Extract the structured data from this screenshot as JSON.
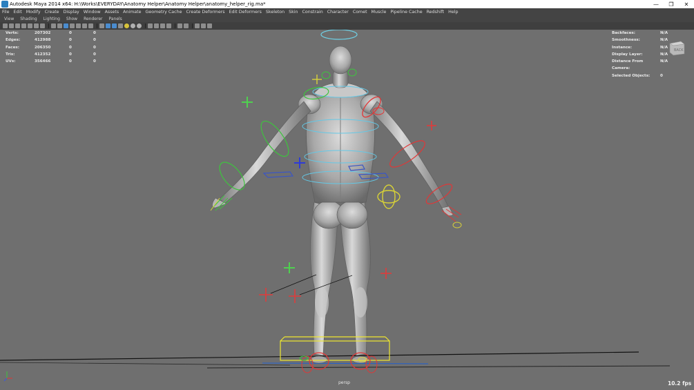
{
  "window": {
    "title": "Autodesk Maya 2014 x64: H:\\Works\\EVERYDAY\\Anatomy Helper\\Anatomy Helper\\anatomy_helper_rig.ma*",
    "minimize": "—",
    "restore": "❐",
    "close": "✕"
  },
  "main_menu": [
    "File",
    "Edit",
    "Modify",
    "Create",
    "Display",
    "Window",
    "Assets",
    "Animate",
    "Geometry Cache",
    "Create Deformers",
    "Edit Deformers",
    "Skeleton",
    "Skin",
    "Constrain",
    "Character",
    "Comet",
    "Muscle",
    "Pipeline Cache",
    "Redshift",
    "Help"
  ],
  "panel_menu": [
    "View",
    "Shading",
    "Lighting",
    "Show",
    "Renderer",
    "Panels"
  ],
  "hud_left": [
    {
      "label": "Verts:",
      "v1": "207302",
      "v2": "0",
      "v3": "0"
    },
    {
      "label": "Edges:",
      "v1": "412988",
      "v2": "0",
      "v3": "0"
    },
    {
      "label": "Faces:",
      "v1": "206350",
      "v2": "0",
      "v3": "0"
    },
    {
      "label": "Tris:",
      "v1": "412352",
      "v2": "0",
      "v3": "0"
    },
    {
      "label": "UVs:",
      "v1": "356466",
      "v2": "0",
      "v3": "0"
    }
  ],
  "hud_right": [
    {
      "label": "Backfaces:",
      "value": "N/A"
    },
    {
      "label": "Smoothness:",
      "value": "N/A"
    },
    {
      "label": "Instance:",
      "value": "N/A"
    },
    {
      "label": "Display Layer:",
      "value": "N/A"
    },
    {
      "label": "Distance From Camera:",
      "value": "N/A"
    },
    {
      "label": "Selected Objects:",
      "value": "0"
    }
  ],
  "viewcube_label": "BACK",
  "camera": "persp",
  "fps": "10.2 fps"
}
